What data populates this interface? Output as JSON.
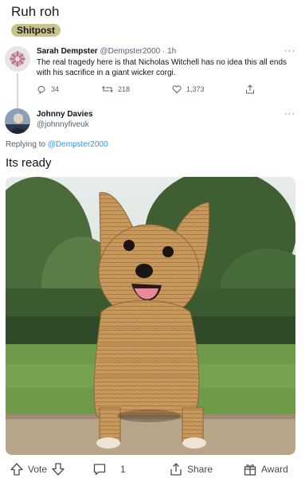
{
  "post": {
    "title": "Ruh roh",
    "flair": "Shitpost"
  },
  "tweet": {
    "author_name": "Sarah Dempster",
    "author_handle": "@Dempster2000",
    "time": "· 1h",
    "text": "The real tragedy here is that Nicholas Witchell has no idea this all ends with his sacrifice in a giant wicker corgi.",
    "replies": "34",
    "retweets": "218",
    "likes": "1,373",
    "more_icon": "more-dots-icon"
  },
  "reply": {
    "author_name": "Johnny Davies",
    "author_handle": "@johnnyfiveuk",
    "replying_label": "Replying to",
    "replying_handle": "@Dempster2000",
    "text": "Its ready"
  },
  "image": {
    "subject": "wicker corgi sculpture on grass"
  },
  "actions": {
    "vote_label": "Vote",
    "comments_count": "1",
    "share_label": "Share",
    "award_label": "Award"
  }
}
